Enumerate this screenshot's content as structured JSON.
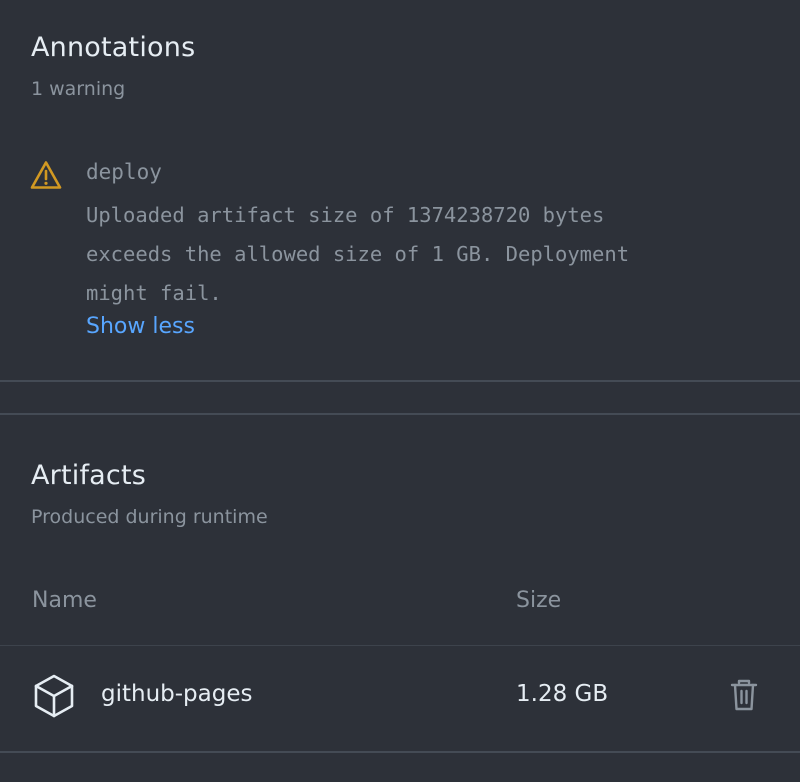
{
  "annotations": {
    "title": "Annotations",
    "subtitle": "1 warning",
    "items": [
      {
        "level_icon": "warning-triangle-icon",
        "job": "deploy",
        "message": "Uploaded artifact size of 1374238720 bytes\nexceeds the allowed size of 1 GB. Deployment\nmight fail.",
        "toggle_label": "Show less"
      }
    ]
  },
  "artifacts": {
    "title": "Artifacts",
    "subtitle": "Produced during runtime",
    "columns": [
      "Name",
      "Size"
    ],
    "rows": [
      {
        "icon": "package-icon",
        "name": "github-pages",
        "size": "1.28 GB",
        "action_icon": "trash-icon"
      }
    ]
  },
  "colors": {
    "background": "#2d3139",
    "text_primary": "#e6edf3",
    "text_muted": "#8b949e",
    "link": "#58a6ff",
    "warning": "#d29922",
    "divider": "#444b55"
  }
}
